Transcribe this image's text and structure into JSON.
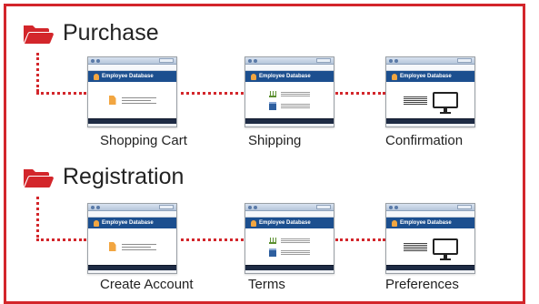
{
  "groups": [
    {
      "title": "Purchase",
      "steps": [
        {
          "label": "Shopping Cart"
        },
        {
          "label": "Shipping"
        },
        {
          "label": "Confirmation"
        }
      ]
    },
    {
      "title": "Registration",
      "steps": [
        {
          "label": "Create Account"
        },
        {
          "label": "Terms"
        },
        {
          "label": "Preferences"
        }
      ]
    }
  ],
  "thumbnail": {
    "app_title": "Employee Database"
  },
  "icons": {
    "folder": "open-folder-icon"
  },
  "colors": {
    "accent": "#d3262b",
    "app_header": "#1c4f8f",
    "dark_footer": "#1e2b44",
    "icon_orange": "#f2a641"
  }
}
